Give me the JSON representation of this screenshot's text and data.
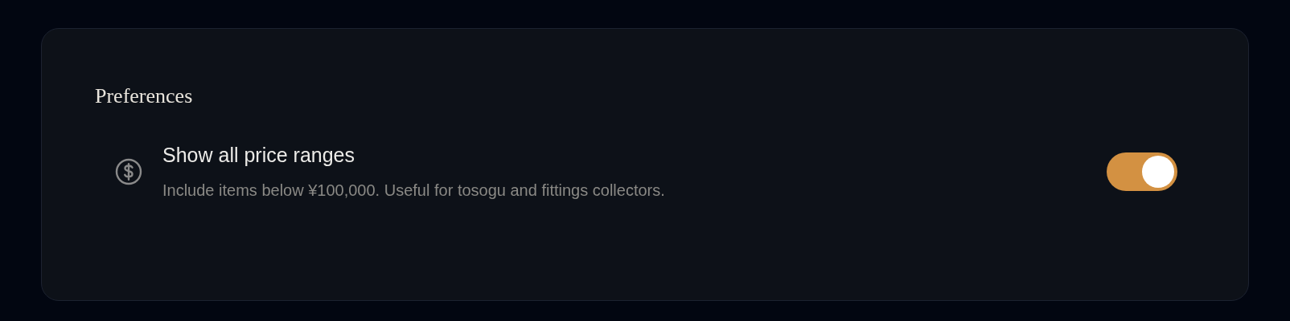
{
  "section": {
    "title": "Preferences"
  },
  "settings": [
    {
      "title": "Show all price ranges",
      "description": "Include items below ¥100,000. Useful for tosogu and fittings collectors.",
      "on": true
    }
  ]
}
